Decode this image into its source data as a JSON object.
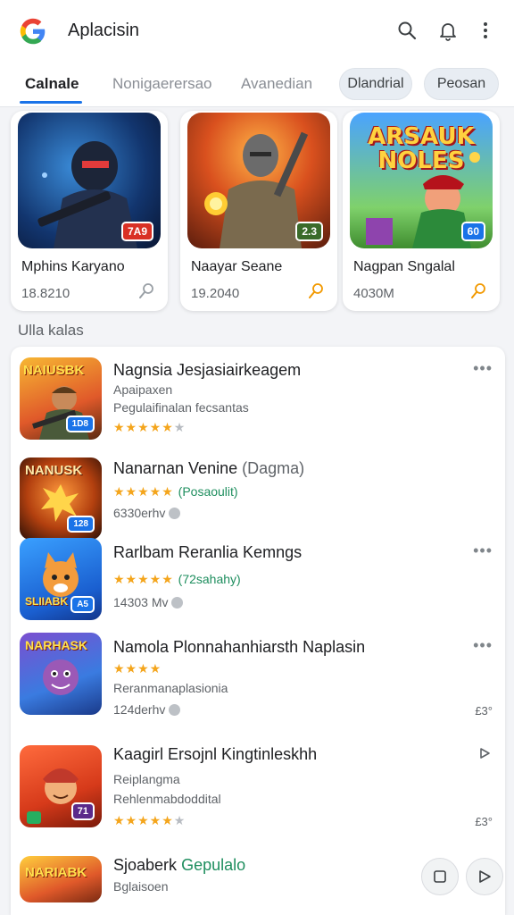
{
  "header": {
    "title": "Aplacisin",
    "icons": [
      "google-logo-icon",
      "search-icon",
      "bell-icon",
      "more-vert-icon"
    ]
  },
  "tabs": [
    {
      "label": "Calnale",
      "active": true
    },
    {
      "label": "Nonigaerersao",
      "active": false
    },
    {
      "label": "Avanedian",
      "active": false
    }
  ],
  "chips": [
    "Dlandrial",
    "Peosan"
  ],
  "featured": [
    {
      "name": "Mphins Karyano",
      "size": "18.8210",
      "badge": "7A9",
      "badge_color": "#d93025"
    },
    {
      "name": "Naayar Seane",
      "size": "19.2040",
      "badge": "2.3",
      "badge_color": "#3a6b2a"
    },
    {
      "name": "Nagpan Sngalal",
      "size": "4030M",
      "badge": "60",
      "badge_color": "#1a73e8",
      "art_text": "ARSAUK NOLES"
    }
  ],
  "section_title": "Ulla kalas",
  "list": [
    {
      "title": "Nagnsia Jesjasiairkeagem",
      "sub1": "Apaipaxen",
      "sub2": "Pegulaifinalan fecsantas",
      "stars": "★★★★★",
      "badge": "1D8",
      "art_text": "NAIUSBK"
    },
    {
      "title": "Nanarnan Venine",
      "title_suffix": "(Dagma)",
      "stars": "★★★★★",
      "rating_note": "(Posaoulit)",
      "meta": "6330erhv",
      "badge": "128",
      "art_text": "NANUSK"
    },
    {
      "title": "Rarlbam Reranlia Kemngs",
      "stars": "★★★★★",
      "rating_note": "(72sahahy)",
      "meta": "14303 Mv",
      "badge": "A5",
      "art_text": "SLIIABK"
    },
    {
      "title": "Namola Plonnahanhiarsth Naplasin",
      "stars": "★★★★",
      "sub1": "Reranmanaplasionia",
      "meta": "124derhv",
      "trail": "£3°",
      "badge": "",
      "art_text": "NARHASK"
    },
    {
      "title": "Kaagirl Ersojnl Kingtinleskhh",
      "sub1": "Reiplangma",
      "sub2": "Rehlenmabdoddital",
      "stars": "★★★★★",
      "trail": "£3°",
      "badge": "71",
      "trail_icon": "play-icon"
    },
    {
      "title": "Sjoaberk",
      "title_suffix": "Gepulalo",
      "sub1": "Bglaisoen",
      "art_text": "NARIABK"
    }
  ],
  "colors": {
    "accent": "#1a73e8",
    "star": "#f4a51c",
    "green": "#1e8e5e"
  }
}
